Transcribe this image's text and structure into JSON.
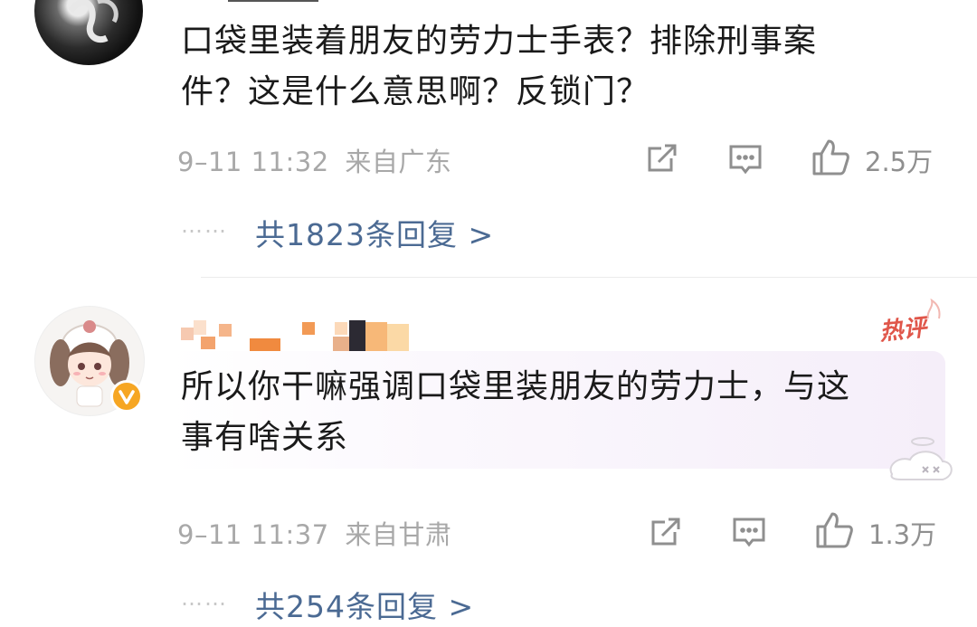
{
  "comments": [
    {
      "text_line1": "口袋里装着朋友的劳力士手表？排除刑事案",
      "text_line2": "件？这是什么意思啊？反锁门？",
      "time": "9–11 11:32",
      "location": "来自广东",
      "likes": "2.5万",
      "replies": "共1823条回复 >"
    },
    {
      "badge": "热评",
      "text_line1": "所以你干嘛强调口袋里装朋友的劳力士，与这",
      "text_line2": "事有啥关系",
      "time": "9–11 11:37",
      "location": "来自甘肃",
      "likes": "1.3万",
      "replies": "共254条回复 >"
    }
  ],
  "dots": "……",
  "colors": {
    "link": "#4b6a93",
    "meta": "#a8a8a8",
    "hot": "#e0564a",
    "verified": "#f6a623"
  },
  "icons": [
    "share-icon",
    "comment-icon",
    "like-icon",
    "verified-icon"
  ]
}
